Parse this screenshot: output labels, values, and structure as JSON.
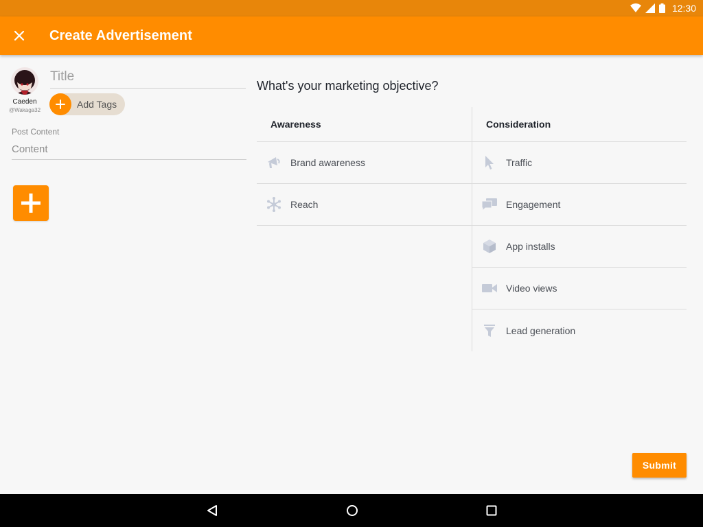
{
  "status_bar": {
    "time": "12:30"
  },
  "app_bar": {
    "title": "Create Advertisement"
  },
  "user": {
    "name": "Caeden",
    "handle": "@Wakaga32"
  },
  "form": {
    "title_placeholder": "Title",
    "tags_label": "Add Tags",
    "post_content_label": "Post Content",
    "content_placeholder": "Content"
  },
  "objective": {
    "question": "What's your marketing objective?",
    "columns": [
      {
        "header": "Awareness",
        "items": [
          {
            "label": "Brand awareness",
            "icon": "megaphone-icon"
          },
          {
            "label": "Reach",
            "icon": "network-icon"
          }
        ]
      },
      {
        "header": "Consideration",
        "items": [
          {
            "label": "Traffic",
            "icon": "cursor-icon"
          },
          {
            "label": "Engagement",
            "icon": "chat-bubbles-icon"
          },
          {
            "label": "App installs",
            "icon": "cube-icon"
          },
          {
            "label": "Video views",
            "icon": "video-camera-icon"
          },
          {
            "label": "Lead generation",
            "icon": "funnel-icon"
          }
        ]
      }
    ]
  },
  "actions": {
    "submit_label": "Submit"
  },
  "colors": {
    "accent": "#ff8c00",
    "status_bar": "#e8860a",
    "icon_gray": "#c5cbd8"
  }
}
